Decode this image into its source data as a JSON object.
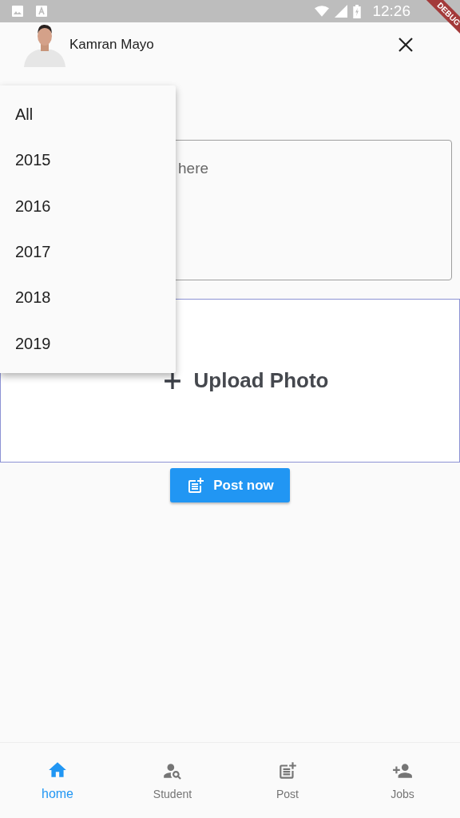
{
  "status_bar": {
    "time": "12:26"
  },
  "debug_banner": "DEBUG",
  "header": {
    "user_name": "Kamran Mayo"
  },
  "year_menu": {
    "items": [
      "All",
      "2015",
      "2016",
      "2017",
      "2018",
      "2019"
    ]
  },
  "text_field": {
    "placeholder": "here"
  },
  "upload": {
    "label": "Upload Photo"
  },
  "post_button": {
    "label": "Post now"
  },
  "bottom_nav": [
    {
      "label": "home",
      "kind": "home",
      "selected": true
    },
    {
      "label": "Student",
      "kind": "student",
      "selected": false
    },
    {
      "label": "Post",
      "kind": "post",
      "selected": false
    },
    {
      "label": "Jobs",
      "kind": "jobs",
      "selected": false
    }
  ]
}
